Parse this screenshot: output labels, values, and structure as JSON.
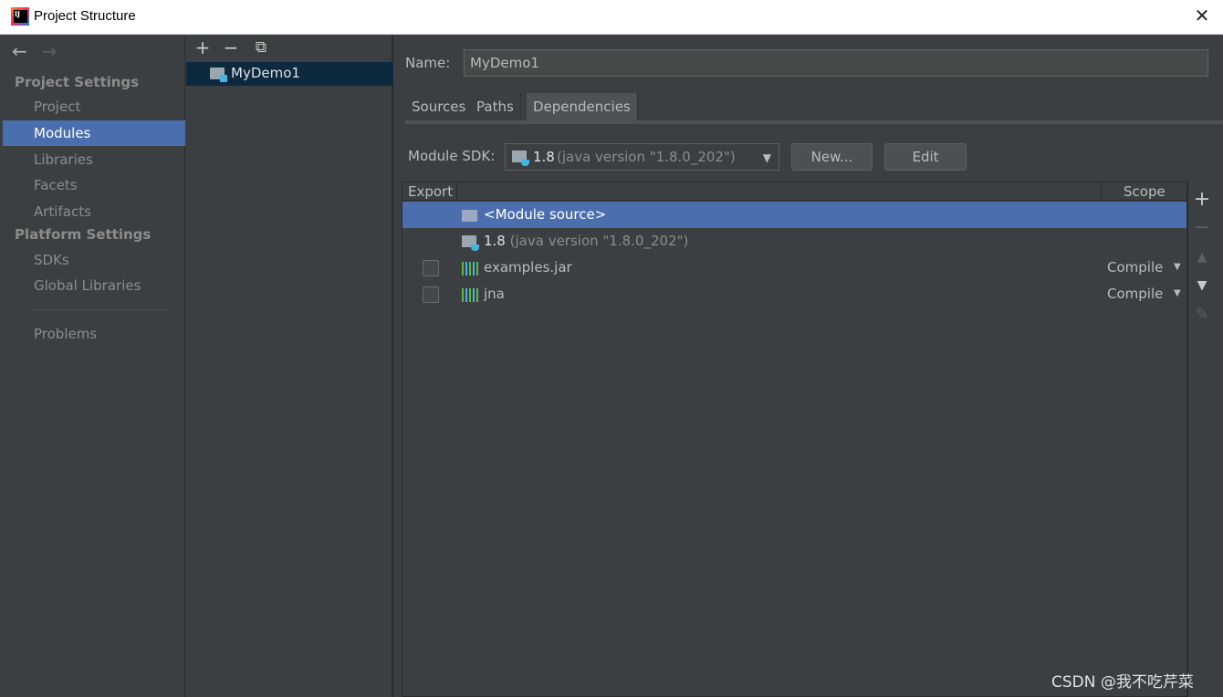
{
  "window": {
    "title": "Project Structure",
    "close_glyph": "✕"
  },
  "sidebar": {
    "back_glyph": "←",
    "forward_glyph": "→",
    "group1": "Project Settings",
    "group2": "Platform Settings",
    "items": [
      {
        "label": "Project"
      },
      {
        "label": "Modules",
        "selected": true
      },
      {
        "label": "Libraries"
      },
      {
        "label": "Facets"
      },
      {
        "label": "Artifacts"
      }
    ],
    "platform_items": [
      {
        "label": "SDKs"
      },
      {
        "label": "Global Libraries"
      }
    ],
    "problems": "Problems"
  },
  "modules": {
    "toolbar": {
      "add": "+",
      "remove": "−",
      "copy": "⧉"
    },
    "items": [
      {
        "label": "MyDemo1"
      }
    ]
  },
  "module": {
    "name_label": "Name:",
    "name_value": "MyDemo1",
    "tabs": [
      "Sources",
      "Paths",
      "Dependencies"
    ],
    "active_tab": "Dependencies",
    "sdk_label": "Module SDK:",
    "sdk_version": "1.8",
    "sdk_detail": "(java version \"1.8.0_202\")",
    "new_button": "New...",
    "edit_button": "Edit"
  },
  "dependencies": {
    "headers": {
      "export": "Export",
      "scope": "Scope"
    },
    "rows": [
      {
        "label": "<Module source>",
        "type": "module-source",
        "selected": true
      },
      {
        "version": "1.8",
        "detail": "(java version \"1.8.0_202\")",
        "type": "sdk"
      },
      {
        "label": "examples.jar",
        "type": "library",
        "scope": "Compile",
        "export": false
      },
      {
        "label": "jna",
        "type": "library",
        "scope": "Compile",
        "export": false
      }
    ],
    "tools": {
      "add": "+",
      "remove": "−",
      "up": "▲",
      "down": "▼",
      "edit": "✎"
    }
  },
  "watermark": "CSDN @我不吃芹菜",
  "colors": {
    "selection": "#4b6eaf",
    "background": "#3c3f41",
    "module_selected": "#0d293e"
  }
}
